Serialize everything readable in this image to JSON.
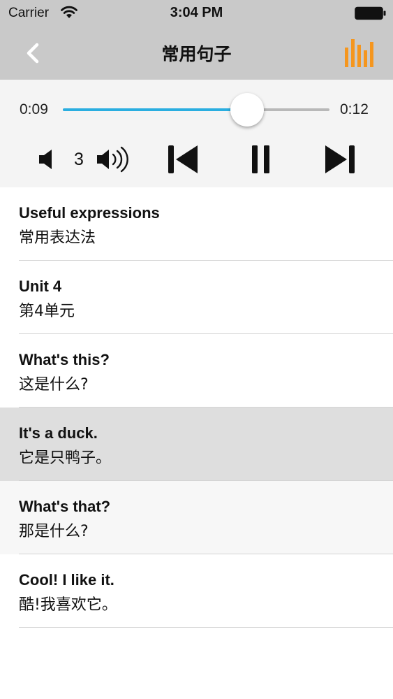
{
  "status_bar": {
    "carrier": "Carrier",
    "time": "3:04 PM"
  },
  "nav": {
    "title": "常用句子",
    "back_icon": "chevron-left-icon",
    "right_icon": "equalizer-icon"
  },
  "player": {
    "current_time": "0:09",
    "total_time": "0:12",
    "progress": 0.69,
    "volume_level": "3",
    "state": "playing"
  },
  "colors": {
    "header_bg": "#c9c9c9",
    "player_bg": "#f4f4f4",
    "progress_fill": "#2aaee0",
    "accent": "#f5961e",
    "selected_row": "#dedede"
  },
  "sentences": [
    {
      "en": "Useful expressions",
      "cn": "常用表达法"
    },
    {
      "en": "Unit 4",
      "cn": "第4单元"
    },
    {
      "en": "What's this?",
      "cn": "这是什么?"
    },
    {
      "en": "It's a duck.",
      "cn": "它是只鸭子。"
    },
    {
      "en": "What's that?",
      "cn": "那是什么?"
    },
    {
      "en": "Cool! I like it.",
      "cn": "酷!我喜欢它。"
    }
  ],
  "selected_index": 3
}
